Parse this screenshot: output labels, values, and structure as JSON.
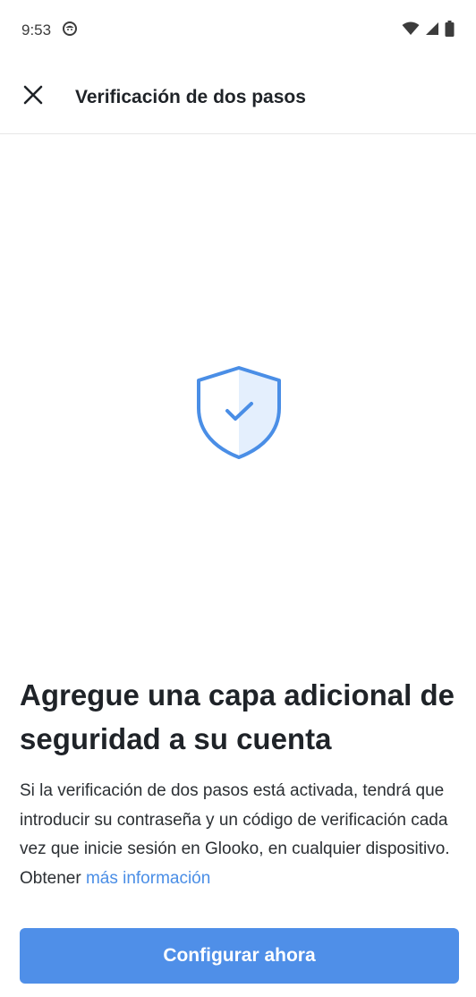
{
  "status_bar": {
    "time": "9:53",
    "icons": [
      "app-notification-icon",
      "wifi-icon",
      "signal-icon",
      "battery-icon"
    ]
  },
  "app_bar": {
    "title": "Verificación de dos pasos",
    "close_icon": "close-icon"
  },
  "hero": {
    "icon": "shield-check-icon",
    "color": "#4a8ee6",
    "fill_color": "#e4effd"
  },
  "content": {
    "headline": "Agregue una capa adicional de seguridad a su cuenta",
    "body": "Si la verificación de dos pasos está activada, tendrá que introducir su contraseña y un código de verificación cada vez que inicie sesión en Glooko, en cualquier dispositivo. Obtener ",
    "link_text": "más información"
  },
  "actions": {
    "primary_label": "Configurar ahora",
    "primary_color": "#4f8fe8"
  }
}
